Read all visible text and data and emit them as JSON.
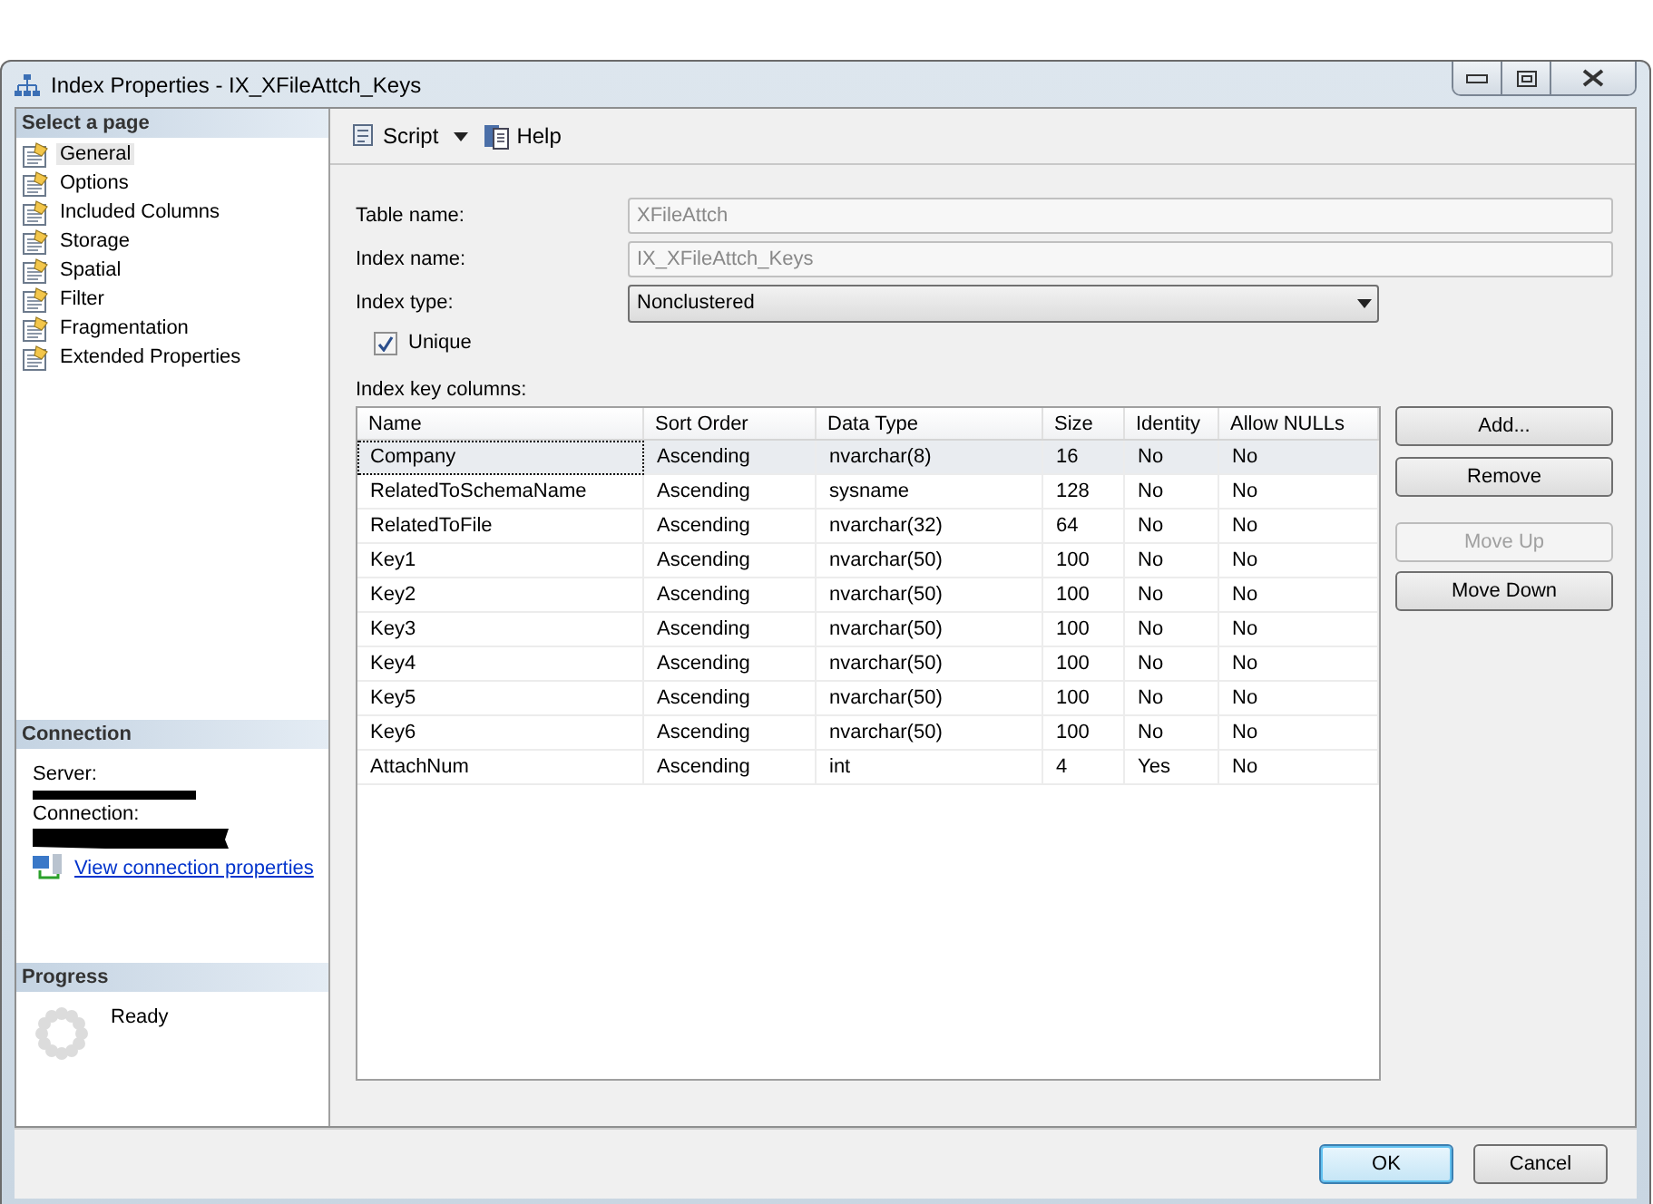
{
  "window": {
    "title": "Index Properties - IX_XFileAttch_Keys"
  },
  "sidebar": {
    "header": "Select a page",
    "items": [
      {
        "label": "General",
        "selected": true
      },
      {
        "label": "Options",
        "selected": false
      },
      {
        "label": "Included Columns",
        "selected": false
      },
      {
        "label": "Storage",
        "selected": false
      },
      {
        "label": "Spatial",
        "selected": false
      },
      {
        "label": "Filter",
        "selected": false
      },
      {
        "label": "Fragmentation",
        "selected": false
      },
      {
        "label": "Extended Properties",
        "selected": false
      }
    ]
  },
  "connection": {
    "header": "Connection",
    "server_label": "Server:",
    "connection_label": "Connection:",
    "link": "View connection properties"
  },
  "progress": {
    "header": "Progress",
    "status": "Ready"
  },
  "toolbar": {
    "script": "Script",
    "help": "Help"
  },
  "form": {
    "table_name": {
      "label": "Table name:",
      "value": "XFileAttch"
    },
    "index_name": {
      "label": "Index name:",
      "value": "IX_XFileAttch_Keys"
    },
    "index_type": {
      "label": "Index type:",
      "value": "Nonclustered"
    },
    "unique": {
      "label": "Unique",
      "checked": true
    }
  },
  "key_columns": {
    "label": "Index key columns:",
    "columns": [
      "Name",
      "Sort Order",
      "Data Type",
      "Size",
      "Identity",
      "Allow NULLs"
    ],
    "rows": [
      {
        "cells": [
          "Company",
          "Ascending",
          "nvarchar(8)",
          "16",
          "No",
          "No"
        ],
        "selected": true
      },
      {
        "cells": [
          "RelatedToSchemaName",
          "Ascending",
          "sysname",
          "128",
          "No",
          "No"
        ],
        "selected": false
      },
      {
        "cells": [
          "RelatedToFile",
          "Ascending",
          "nvarchar(32)",
          "64",
          "No",
          "No"
        ],
        "selected": false
      },
      {
        "cells": [
          "Key1",
          "Ascending",
          "nvarchar(50)",
          "100",
          "No",
          "No"
        ],
        "selected": false
      },
      {
        "cells": [
          "Key2",
          "Ascending",
          "nvarchar(50)",
          "100",
          "No",
          "No"
        ],
        "selected": false
      },
      {
        "cells": [
          "Key3",
          "Ascending",
          "nvarchar(50)",
          "100",
          "No",
          "No"
        ],
        "selected": false
      },
      {
        "cells": [
          "Key4",
          "Ascending",
          "nvarchar(50)",
          "100",
          "No",
          "No"
        ],
        "selected": false
      },
      {
        "cells": [
          "Key5",
          "Ascending",
          "nvarchar(50)",
          "100",
          "No",
          "No"
        ],
        "selected": false
      },
      {
        "cells": [
          "Key6",
          "Ascending",
          "nvarchar(50)",
          "100",
          "No",
          "No"
        ],
        "selected": false
      },
      {
        "cells": [
          "AttachNum",
          "Ascending",
          "int",
          "4",
          "Yes",
          "No"
        ],
        "selected": false
      }
    ]
  },
  "side_buttons": [
    {
      "label": "Add...",
      "disabled": false
    },
    {
      "label": "Remove",
      "disabled": false
    },
    {
      "label": "Move Up",
      "disabled": true
    },
    {
      "label": "Move Down",
      "disabled": false
    }
  ],
  "buttons": [
    {
      "label": "OK",
      "kind": "default"
    },
    {
      "label": "Cancel",
      "kind": "normal"
    }
  ]
}
